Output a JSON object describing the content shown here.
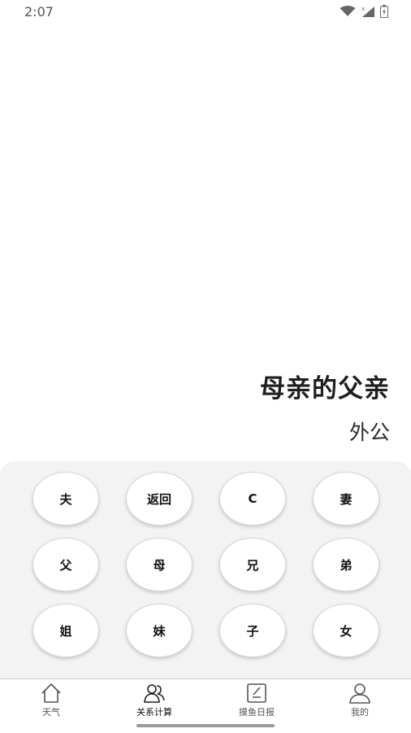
{
  "status": {
    "time": "2:07"
  },
  "calculator": {
    "expression": "母亲的父亲",
    "result": "外公"
  },
  "keys": {
    "husband": "夫",
    "back": "返回",
    "clear": "C",
    "wife": "妻",
    "father": "父",
    "mother": "母",
    "elder_brother": "兄",
    "younger_brother": "弟",
    "elder_sister": "姐",
    "younger_sister": "妹",
    "son": "子",
    "daughter": "女"
  },
  "tabs": [
    {
      "label": "天气",
      "icon": "home-icon",
      "active": false
    },
    {
      "label": "关系计算",
      "icon": "people-icon",
      "active": true
    },
    {
      "label": "摸鱼日报",
      "icon": "note-icon",
      "active": false
    },
    {
      "label": "我的",
      "icon": "person-icon",
      "active": false
    }
  ]
}
